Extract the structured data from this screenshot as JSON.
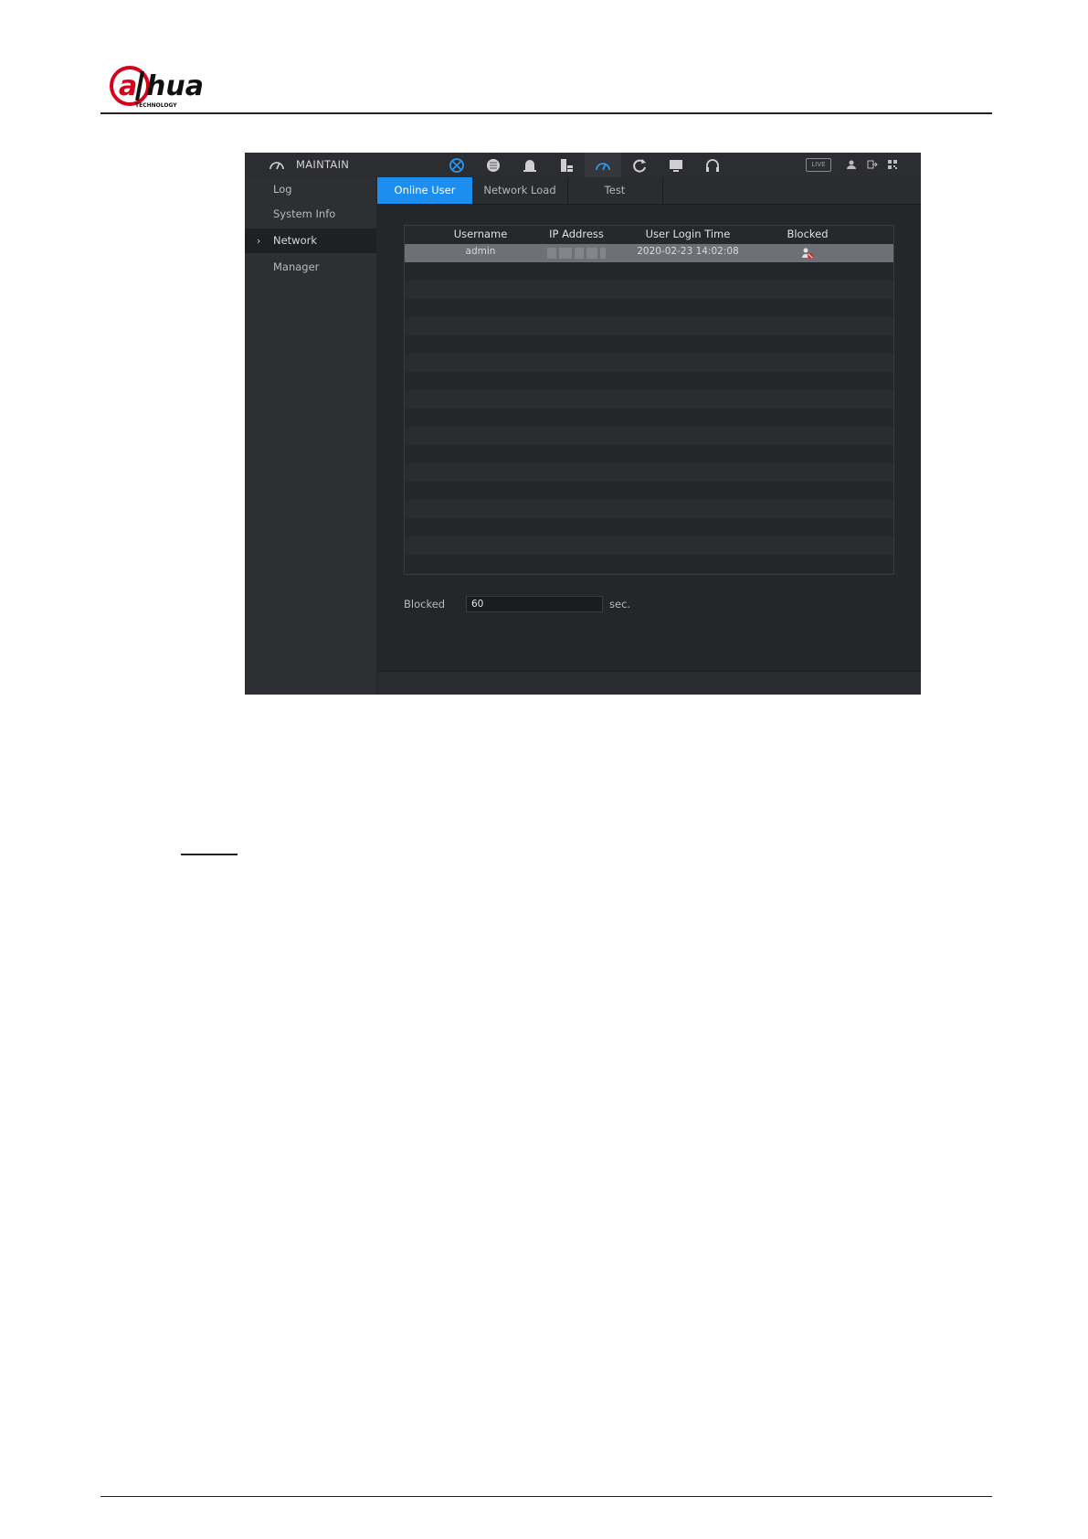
{
  "logo": {
    "text": "alhua",
    "subtext": "TECHNOLOGY",
    "accent_color": "#d6001c"
  },
  "app": {
    "title": "MAINTAIN",
    "nav_icons": [
      "display-icon",
      "ai-brain-icon",
      "alarm-bell-icon",
      "storage-icon",
      "maintain-gauge-icon",
      "backup-icon",
      "monitor-icon",
      "headset-icon"
    ],
    "active_nav": "maintain-gauge-icon",
    "live_label": "LIVE"
  },
  "sidebar": {
    "items": [
      {
        "label": "Log"
      },
      {
        "label": "System Info"
      },
      {
        "label": "Network",
        "active": true
      },
      {
        "label": "Manager"
      }
    ]
  },
  "tabs": [
    {
      "label": "Online User",
      "active": true
    },
    {
      "label": "Network Load"
    },
    {
      "label": "Test"
    }
  ],
  "table": {
    "columns": [
      "Username",
      "IP Address",
      "User Login Time",
      "Blocked"
    ],
    "rows": [
      {
        "username": "admin",
        "ip": "",
        "login_time": "2020-02-23 14:02:08",
        "blocked_icon": "block-user-icon"
      }
    ]
  },
  "blocked": {
    "label": "Blocked",
    "value": "60",
    "unit": "sec."
  },
  "colors": {
    "accent": "#1b8ef0",
    "background": "#232428"
  }
}
